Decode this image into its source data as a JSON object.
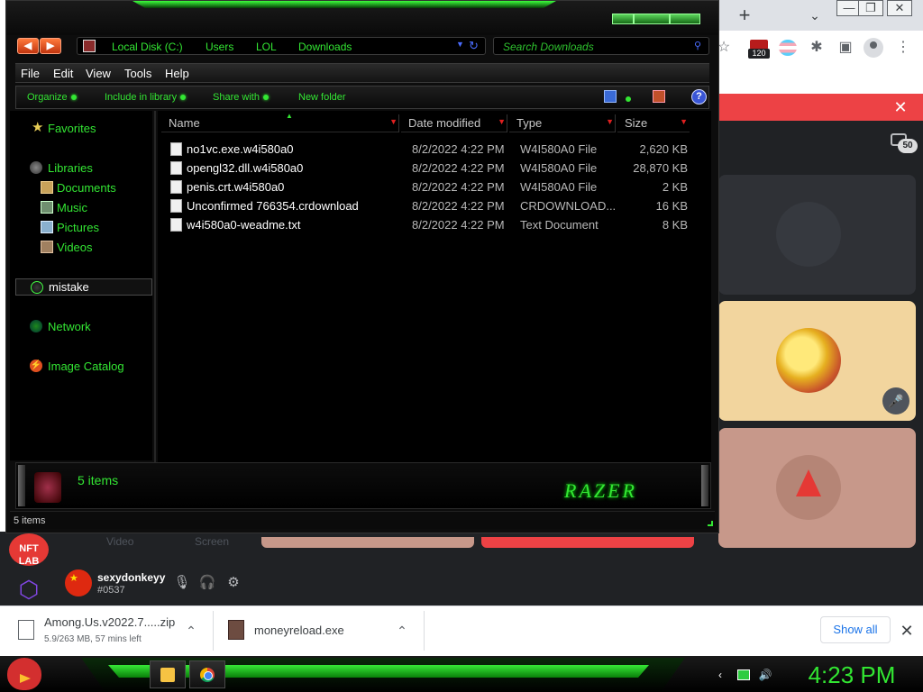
{
  "explorer": {
    "address": {
      "crumbs": [
        "Local Disk (C:)",
        "Users",
        "LOL",
        "Downloads"
      ]
    },
    "search": {
      "placeholder": "Search Downloads"
    },
    "menu": [
      "File",
      "Edit",
      "View",
      "Tools",
      "Help"
    ],
    "commands": [
      "Organize",
      "Include in library",
      "Share with",
      "New folder"
    ],
    "nav": {
      "favorites": "Favorites",
      "libraries": "Libraries",
      "library_items": [
        "Documents",
        "Music",
        "Pictures",
        "Videos"
      ],
      "selected": "mistake",
      "network": "Network",
      "catalog": "Image Catalog"
    },
    "columns": [
      "Name",
      "Date modified",
      "Type",
      "Size"
    ],
    "files": [
      {
        "name": "no1vc.exe.w4i580a0",
        "date": "8/2/2022 4:22 PM",
        "type": "W4I580A0 File",
        "size": "2,620 KB"
      },
      {
        "name": "opengl32.dll.w4i580a0",
        "date": "8/2/2022 4:22 PM",
        "type": "W4I580A0 File",
        "size": "28,870 KB"
      },
      {
        "name": "penis.crt.w4i580a0",
        "date": "8/2/2022 4:22 PM",
        "type": "W4I580A0 File",
        "size": "2 KB"
      },
      {
        "name": "Unconfirmed 766354.crdownload",
        "date": "8/2/2022 4:22 PM",
        "type": "CRDOWNLOAD...",
        "size": "16 KB"
      },
      {
        "name": "w4i580a0-weadme.txt",
        "date": "8/2/2022 4:22 PM",
        "type": "Text Document",
        "size": "8 KB"
      }
    ],
    "details_count": "5 items",
    "brand": "RAZER",
    "status": "5 items"
  },
  "chrome": {
    "new_tab": "+",
    "ext_badge": "120",
    "window_controls": [
      "—",
      "❐",
      "✕"
    ]
  },
  "discord": {
    "participants_count": "50",
    "faded_labels": [
      "Video",
      "Screen"
    ],
    "logo_nft": "NFT LAB",
    "username": "sexydonkeyy",
    "usertag": "#0537"
  },
  "downloads": {
    "items": [
      {
        "name": "Among.Us.v2022.7.....zip",
        "sub": "5.9/263 MB, 57 mins left"
      },
      {
        "name": "moneyreload.exe"
      }
    ],
    "show_all": "Show all",
    "close": "✕"
  },
  "taskbar": {
    "clock": "4:23 PM"
  },
  "colors": {
    "explorer_green": "#33e633",
    "discord_red": "#ed4245",
    "chrome_blue": "#1a73e8"
  }
}
